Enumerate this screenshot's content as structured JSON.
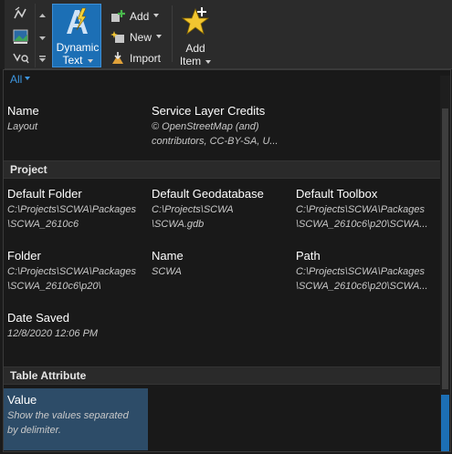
{
  "ribbon": {
    "dynamic_text": {
      "line1": "Dynamic",
      "line2": "Text"
    },
    "add": "Add",
    "new": "New",
    "import": "Import",
    "add_item": {
      "line1": "Add",
      "line2": "Item"
    }
  },
  "gallery": {
    "filter": "All",
    "tiles_top": [
      {
        "name": "Name",
        "value": "Layout"
      },
      {
        "name": "Service Layer Credits",
        "value": "© OpenStreetMap (and)\ncontributors, CC-BY-SA, U..."
      }
    ],
    "sections": [
      {
        "title": "Project",
        "tiles": [
          {
            "name": "Default Folder",
            "value": "C:\\Projects\\SCWA\\Packages\n\\SCWA_2610c6"
          },
          {
            "name": "Default Geodatabase",
            "value": "C:\\Projects\\SCWA\n\\SCWA.gdb"
          },
          {
            "name": "Default Toolbox",
            "value": "C:\\Projects\\SCWA\\Packages\n\\SCWA_2610c6\\p20\\SCWA..."
          },
          {
            "name": "Folder",
            "value": "C:\\Projects\\SCWA\\Packages\n\\SCWA_2610c6\\p20\\"
          },
          {
            "name": "Name",
            "value": "SCWA"
          },
          {
            "name": "Path",
            "value": "C:\\Projects\\SCWA\\Packages\n\\SCWA_2610c6\\p20\\SCWA..."
          },
          {
            "name": "Date Saved",
            "value": "12/8/2020 12:06 PM"
          }
        ]
      },
      {
        "title": "Table Attribute",
        "tiles": [
          {
            "name": "Value",
            "value": "Show the values separated\nby delimiter."
          }
        ]
      }
    ]
  },
  "colors": {
    "accent": "#1c6fb5",
    "selected_tile": "#2d4c68",
    "filter_link": "#3d96e0"
  }
}
